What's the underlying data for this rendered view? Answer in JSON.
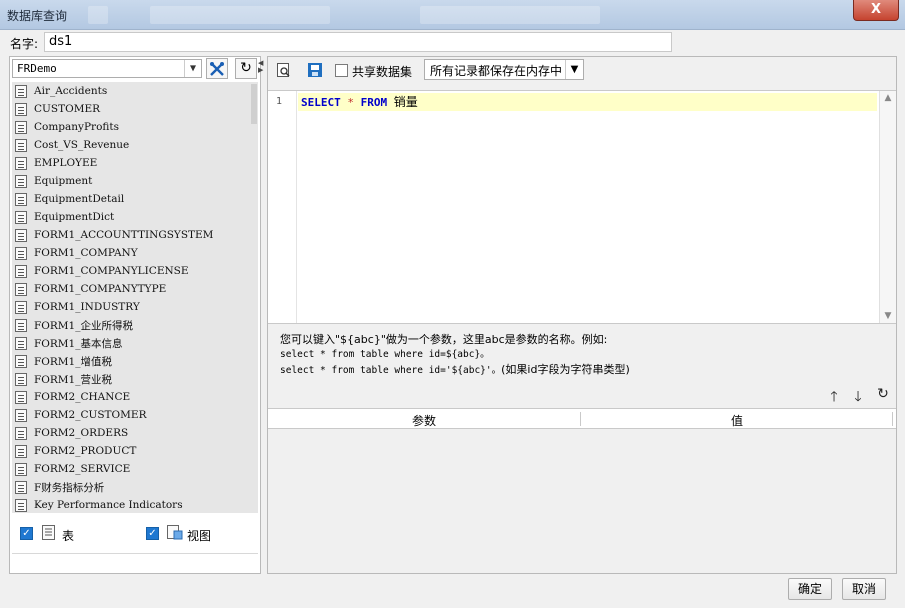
{
  "window": {
    "title": "数据库查询",
    "close_label": "X"
  },
  "name_field": {
    "label": "名字:",
    "value": "ds1"
  },
  "left_panel": {
    "database": "FRDemo",
    "tables": [
      "Air_Accidents",
      "CUSTOMER",
      "CompanyProfits",
      "Cost_VS_Revenue",
      "EMPLOYEE",
      "Equipment",
      "EquipmentDetail",
      "EquipmentDict",
      "FORM1_ACCOUNTTINGSYSTEM",
      "FORM1_COMPANY",
      "FORM1_COMPANYLICENSE",
      "FORM1_COMPANYTYPE",
      "FORM1_INDUSTRY",
      "FORM1_企业所得税",
      "FORM1_基本信息",
      "FORM1_增值税",
      "FORM1_营业税",
      "FORM2_CHANCE",
      "FORM2_CUSTOMER",
      "FORM2_ORDERS",
      "FORM2_PRODUCT",
      "FORM2_SERVICE",
      "F财务指标分析",
      "Key Performance Indicators"
    ],
    "filters": {
      "table_label": "表",
      "view_label": "视图"
    }
  },
  "query_toolbar": {
    "share_label": "共享数据集",
    "mode_option": "所有记录都保存在内存中"
  },
  "editor": {
    "line_number": "1",
    "sql": {
      "select": "SELECT",
      "star": "*",
      "from": "FROM",
      "table": "销量"
    }
  },
  "hint": {
    "line1": "您可以键入\"${abc}\"做为一个参数，这里abc是参数的名称。例如:",
    "line2": "select * from table where id=${abc}。",
    "line3a": "select * from table where id='${abc}'。",
    "line3b": "(如果id字段为字符串类型)"
  },
  "params_table": {
    "col_param": "参数",
    "col_value": "值"
  },
  "footer": {
    "ok_label": "确定",
    "cancel_label": "取消"
  },
  "colors": {
    "accent": "#1f78d1",
    "keyword": "#0000cc",
    "current_line": "#ffffc8",
    "close": "#c5432f"
  }
}
